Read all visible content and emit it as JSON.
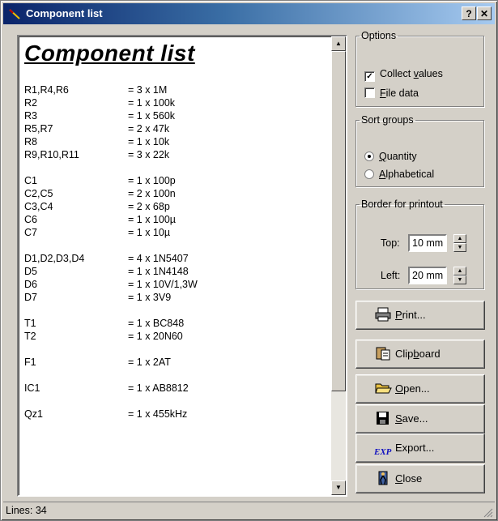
{
  "window": {
    "title": "Component list",
    "help_label": "?",
    "close_label": "✕"
  },
  "report": {
    "title": "Component list",
    "groups": [
      {
        "rows": [
          {
            "ref": "R1,R4,R6",
            "val": "= 3 x 1M"
          },
          {
            "ref": "R2",
            "val": "= 1 x 100k"
          },
          {
            "ref": "R3",
            "val": "= 1 x 560k"
          },
          {
            "ref": "R5,R7",
            "val": "= 2 x 47k"
          },
          {
            "ref": "R8",
            "val": "= 1 x 10k"
          },
          {
            "ref": "R9,R10,R11",
            "val": "= 3 x 22k"
          }
        ]
      },
      {
        "rows": [
          {
            "ref": "C1",
            "val": "= 1 x 100p"
          },
          {
            "ref": "C2,C5",
            "val": "= 2 x 100n"
          },
          {
            "ref": "C3,C4",
            "val": "= 2 x 68p"
          },
          {
            "ref": "C6",
            "val": "= 1 x 100µ"
          },
          {
            "ref": "C7",
            "val": "= 1 x 10µ"
          }
        ]
      },
      {
        "rows": [
          {
            "ref": "D1,D2,D3,D4",
            "val": "= 4 x 1N5407"
          },
          {
            "ref": "D5",
            "val": "= 1 x 1N4148"
          },
          {
            "ref": "D6",
            "val": "= 1 x 10V/1,3W"
          },
          {
            "ref": "D7",
            "val": "= 1 x 3V9"
          }
        ]
      },
      {
        "rows": [
          {
            "ref": "T1",
            "val": "= 1 x BC848"
          },
          {
            "ref": "T2",
            "val": "= 1 x 20N60"
          }
        ]
      },
      {
        "rows": [
          {
            "ref": "F1",
            "val": "= 1 x 2AT"
          }
        ]
      },
      {
        "rows": [
          {
            "ref": "IC1",
            "val": "= 1 x AB8812"
          }
        ]
      },
      {
        "rows": [
          {
            "ref": "Qz1",
            "val": "= 1 x 455kHz"
          }
        ]
      }
    ]
  },
  "options": {
    "legend": "Options",
    "collect_values": {
      "label_pre": "Collect ",
      "label_u": "v",
      "label_post": "alues",
      "checked": true
    },
    "file_data": {
      "label_pre": "",
      "label_u": "F",
      "label_post": "ile data",
      "checked": false
    }
  },
  "sort_groups": {
    "legend": "Sort groups",
    "quantity": {
      "label_pre": "",
      "label_u": "Q",
      "label_post": "uantity",
      "selected": true
    },
    "alphabetical": {
      "label_pre": "",
      "label_u": "A",
      "label_post": "lphabetical",
      "selected": false
    }
  },
  "border": {
    "legend": "Border for printout",
    "top_label": "Top:",
    "top_value": "10 mm",
    "left_label": "Left:",
    "left_value": "20 mm"
  },
  "buttons": {
    "print": {
      "pre": "",
      "u": "P",
      "post": "rint...",
      "icon": "printer-icon"
    },
    "clipboard": {
      "pre": "Clip",
      "u": "b",
      "post": "oard",
      "icon": "clipboard-icon"
    },
    "open": {
      "pre": "",
      "u": "O",
      "post": "pen...",
      "icon": "folder-open-icon"
    },
    "save": {
      "pre": "",
      "u": "S",
      "post": "ave...",
      "icon": "floppy-disk-icon"
    },
    "export": {
      "pre": "Export...",
      "u": "",
      "post": "",
      "icon": "export-icon",
      "icon_text": "EXP"
    },
    "close": {
      "pre": "",
      "u": "C",
      "post": "lose",
      "icon": "door-exit-icon"
    }
  },
  "status": {
    "lines": "Lines: 34"
  },
  "colors": {
    "title_start": "#0a246a",
    "title_end": "#a6caf0",
    "face": "#d4d0c8"
  }
}
